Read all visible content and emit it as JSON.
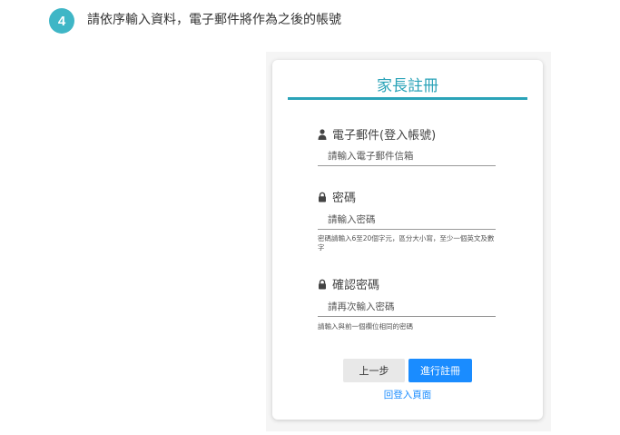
{
  "step": {
    "number": "4",
    "instruction": "請依序輸入資料，電子郵件將作為之後的帳號"
  },
  "form": {
    "title": "家長註冊",
    "email": {
      "icon": "user-icon",
      "label": "電子郵件(登入帳號)",
      "placeholder": "請輸入電子郵件信箱",
      "value": ""
    },
    "password": {
      "icon": "lock-icon",
      "label": "密碼",
      "placeholder": "請輸入密碼",
      "value": "",
      "hint": "密碼請輸入6至20個字元，區分大小寫，至少一個英文及數字"
    },
    "confirm_password": {
      "icon": "lock-icon",
      "label": "確認密碼",
      "placeholder": "請再次輸入密碼",
      "value": "",
      "hint": "請輸入與前一個欄位相同的密碼"
    },
    "prev_button": "上一步",
    "submit_button": "進行註冊",
    "login_link": "回登入頁面"
  },
  "colors": {
    "accent": "#2aa3b8",
    "badge": "#3fb6c6",
    "primary_button": "#1a8cff",
    "secondary_button": "#e8e8e8"
  }
}
